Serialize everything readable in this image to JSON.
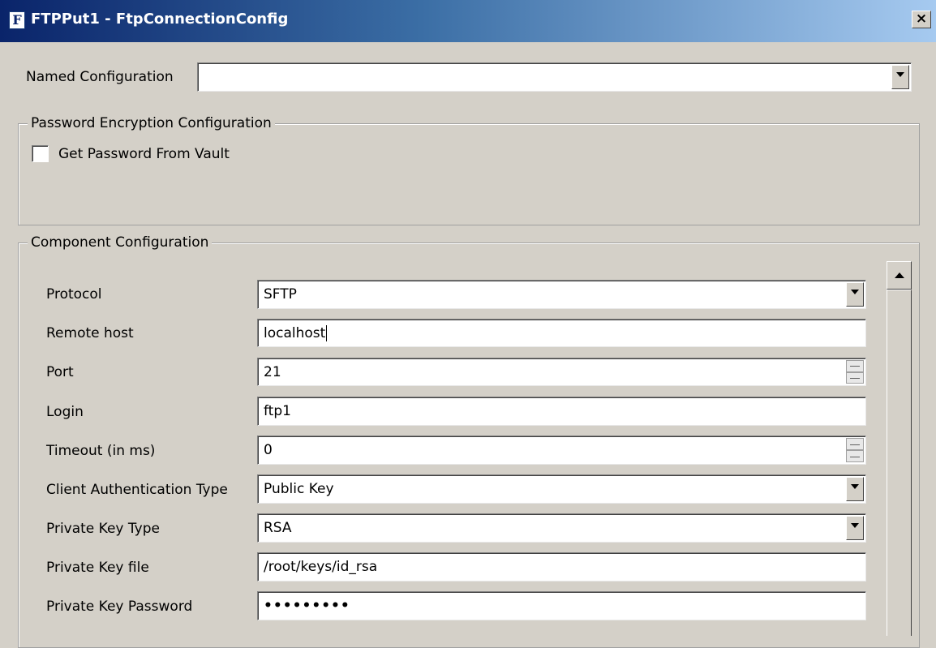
{
  "window": {
    "title": "FTPPut1 - FtpConnectionConfig",
    "app_icon_letter": "F",
    "close_label": "×"
  },
  "named_configuration": {
    "label": "Named Configuration",
    "value": ""
  },
  "password_encryption": {
    "group_title": "Password Encryption Configuration",
    "get_from_vault_label": "Get Password From Vault",
    "get_from_vault_checked": false
  },
  "component": {
    "group_title": "Component Configuration",
    "protocol": {
      "label": "Protocol",
      "value": "SFTP"
    },
    "remote_host": {
      "label": "Remote host",
      "value": "localhost"
    },
    "port": {
      "label": "Port",
      "value": "21"
    },
    "login": {
      "label": "Login",
      "value": "ftp1"
    },
    "timeout": {
      "label": "Timeout (in ms)",
      "value": "0"
    },
    "client_auth_type": {
      "label": "Client Authentication Type",
      "value": "Public Key"
    },
    "private_key_type": {
      "label": "Private Key Type",
      "value": "RSA"
    },
    "private_key_file": {
      "label": "Private Key file",
      "value": "/root/keys/id_rsa"
    },
    "private_key_password": {
      "label": "Private Key Password",
      "value": "•••••••••"
    }
  }
}
